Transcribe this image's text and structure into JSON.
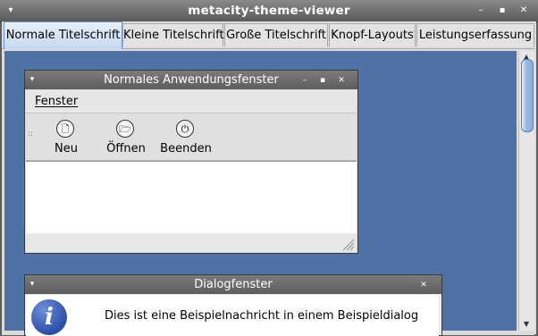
{
  "window": {
    "title": "metacity-theme-viewer",
    "menu_glyph": "▾",
    "min_glyph": "–",
    "max_glyph": "▪",
    "close_glyph": "✕"
  },
  "tabs": [
    {
      "label": "Normale Titelschrift",
      "active": true
    },
    {
      "label": "Kleine Titelschrift",
      "active": false
    },
    {
      "label": "Große Titelschrift",
      "active": false
    },
    {
      "label": "Knopf-Layouts",
      "active": false
    },
    {
      "label": "Leistungserfassung",
      "active": false
    }
  ],
  "normal_window": {
    "title": "Normales Anwendungsfenster",
    "menu": {
      "fenster": "Fenster"
    },
    "toolbar": [
      {
        "label": "Neu",
        "icon": "new-document-icon",
        "glyph": "🗋"
      },
      {
        "label": "Öffnen",
        "icon": "folder-open-icon",
        "glyph": "🗁"
      },
      {
        "label": "Beenden",
        "icon": "power-icon",
        "glyph": "⏻"
      }
    ]
  },
  "dialog": {
    "title": "Dialogfenster",
    "icon_glyph": "i",
    "message": "Dies ist eine Beispielnachricht in einem Beispieldialog"
  },
  "colors": {
    "preview_background": "#4f72a6",
    "active_tab": "#c4d7f0",
    "titlebar": "#5d5d5d"
  }
}
